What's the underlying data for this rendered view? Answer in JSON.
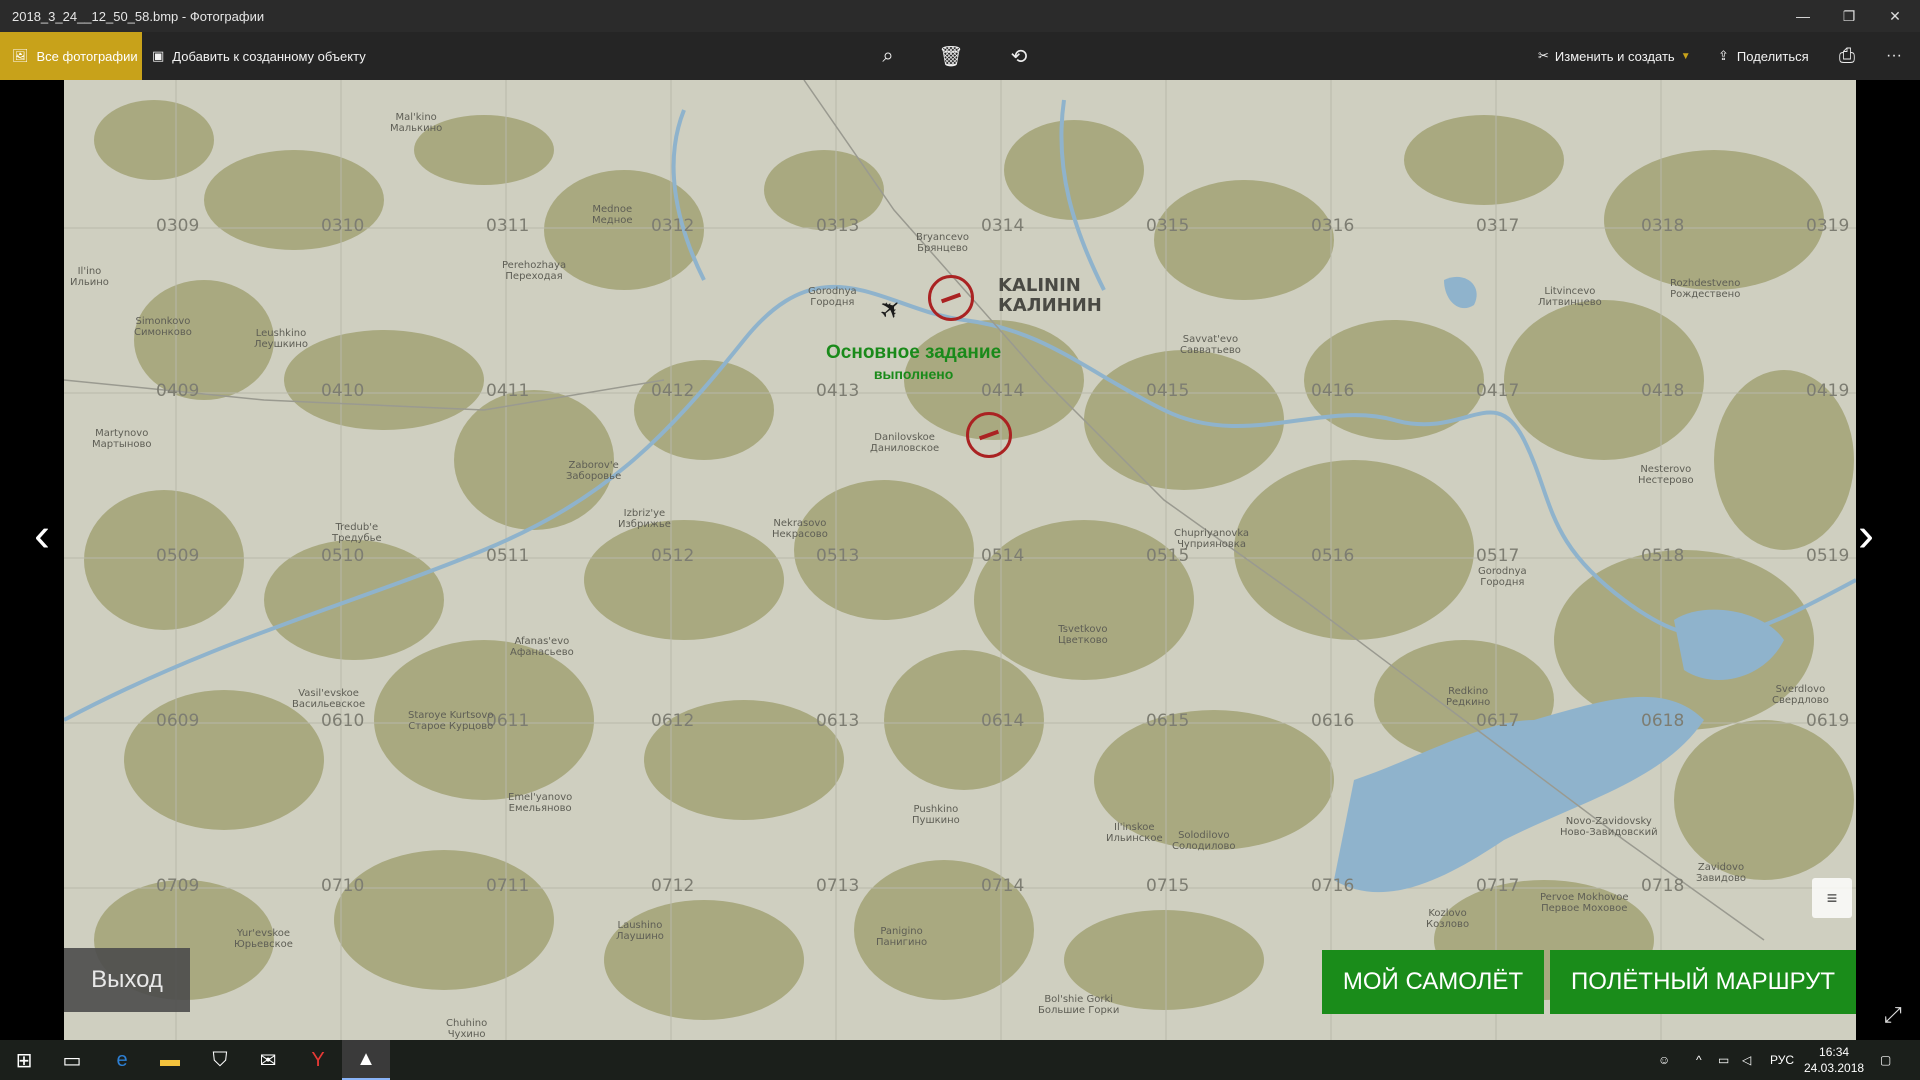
{
  "window": {
    "title": "2018_3_24__12_50_58.bmp - Фотографии",
    "minimize": "—",
    "maximize": "❐",
    "close": "✕"
  },
  "toolbar": {
    "all_photos": "Все фотографии",
    "add_to_creation": "Добавить к созданному объекту",
    "edit_create": "Изменить и создать",
    "share": "Поделиться",
    "more": "···"
  },
  "map": {
    "grid_labels": [
      "0309",
      "0310",
      "0311",
      "0312",
      "0313",
      "0314",
      "0315",
      "0316",
      "0317",
      "0318",
      "0319",
      "0409",
      "0410",
      "0411",
      "0412",
      "0413",
      "0414",
      "0415",
      "0416",
      "0417",
      "0418",
      "0419",
      "0509",
      "0510",
      "0511",
      "0512",
      "0513",
      "0514",
      "0515",
      "0516",
      "0517",
      "0518",
      "0519",
      "0609",
      "0610",
      "0611",
      "0612",
      "0613",
      "0614",
      "0615",
      "0616",
      "0617",
      "0618",
      "0619",
      "0709",
      "0710",
      "0711",
      "0712",
      "0713",
      "0714",
      "0715",
      "0716",
      "0717",
      "0718"
    ],
    "city_name_en": "KALININ",
    "city_name_ru": "КАЛИНИН",
    "towns": [
      {
        "en": "Mal'kino",
        "ru": "Малькино"
      },
      {
        "en": "Mednoe",
        "ru": "Медное"
      },
      {
        "en": "Bryancevo",
        "ru": "Брянцево"
      },
      {
        "en": "Perehozhaya",
        "ru": "Переходая"
      },
      {
        "en": "Il'ino",
        "ru": "Ильино"
      },
      {
        "en": "Simonkovo",
        "ru": "Симонково"
      },
      {
        "en": "Leushkino",
        "ru": "Леушкино"
      },
      {
        "en": "Gorodnya",
        "ru": "Городня"
      },
      {
        "en": "Savvat'evo",
        "ru": "Савватьево"
      },
      {
        "en": "Litvincevo",
        "ru": "Литвинцево"
      },
      {
        "en": "Rozhdestveno",
        "ru": "Рождествено"
      },
      {
        "en": "Martynovo",
        "ru": "Мартыново"
      },
      {
        "en": "Danilovskoe",
        "ru": "Даниловское"
      },
      {
        "en": "Zaborov'e",
        "ru": "Заборовье"
      },
      {
        "en": "Nesterovo",
        "ru": "Нестерово"
      },
      {
        "en": "Tredub'e",
        "ru": "Тредубье"
      },
      {
        "en": "Izbriz'ye",
        "ru": "Избрижье"
      },
      {
        "en": "Nekrasovo",
        "ru": "Некрасово"
      },
      {
        "en": "Chupriyanovka",
        "ru": "Чуприяновка"
      },
      {
        "en": "Gorodnya",
        "ru": "Городня"
      },
      {
        "en": "Tsvetkovo",
        "ru": "Цветково"
      },
      {
        "en": "Afanas'evo",
        "ru": "Афанасьево"
      },
      {
        "en": "Vasil'evskoe",
        "ru": "Васильевское"
      },
      {
        "en": "Staroye Kurtsovo",
        "ru": "Старое Курцово"
      },
      {
        "en": "Redkino",
        "ru": "Редкино"
      },
      {
        "en": "Sverdlovo",
        "ru": "Свердлово"
      },
      {
        "en": "Emel'yanovo",
        "ru": "Емельяново"
      },
      {
        "en": "Pushkino",
        "ru": "Пушкино"
      },
      {
        "en": "Il'inskoe",
        "ru": "Ильинское"
      },
      {
        "en": "Solodilovo",
        "ru": "Солодилово"
      },
      {
        "en": "Novo-Zavidovsky",
        "ru": "Ново-Завидовский"
      },
      {
        "en": "Zavidovo",
        "ru": "Завидово"
      },
      {
        "en": "Yur'evskoe",
        "ru": "Юрьевское"
      },
      {
        "en": "Laushino",
        "ru": "Лаушино"
      },
      {
        "en": "Panigino",
        "ru": "Панигино"
      },
      {
        "en": "Kozlovo",
        "ru": "Козлово"
      },
      {
        "en": "Pervoe Mokhovoe",
        "ru": "Первое Моховое"
      },
      {
        "en": "Bol'shie Gorki",
        "ru": "Большие Горки"
      },
      {
        "en": "Chuhino",
        "ru": "Чухино"
      }
    ],
    "mission_title": "Основное задание",
    "mission_status": "выполнено"
  },
  "buttons": {
    "exit": "Выход",
    "my_plane": "МОЙ САМОЛЁТ",
    "flight_route": "ПОЛЁТНЫЙ МАРШРУТ"
  },
  "taskbar": {
    "language": "РУС",
    "time": "16:34",
    "date": "24.03.2018"
  },
  "colors": {
    "accent_yellow": "#c8a21a",
    "green_button": "#1a8c1a",
    "mission_green": "#1a8a1a",
    "target_red": "#aa2222",
    "forest": "#a9a980",
    "field": "#cfcfc0",
    "water": "#8fb3cc"
  }
}
